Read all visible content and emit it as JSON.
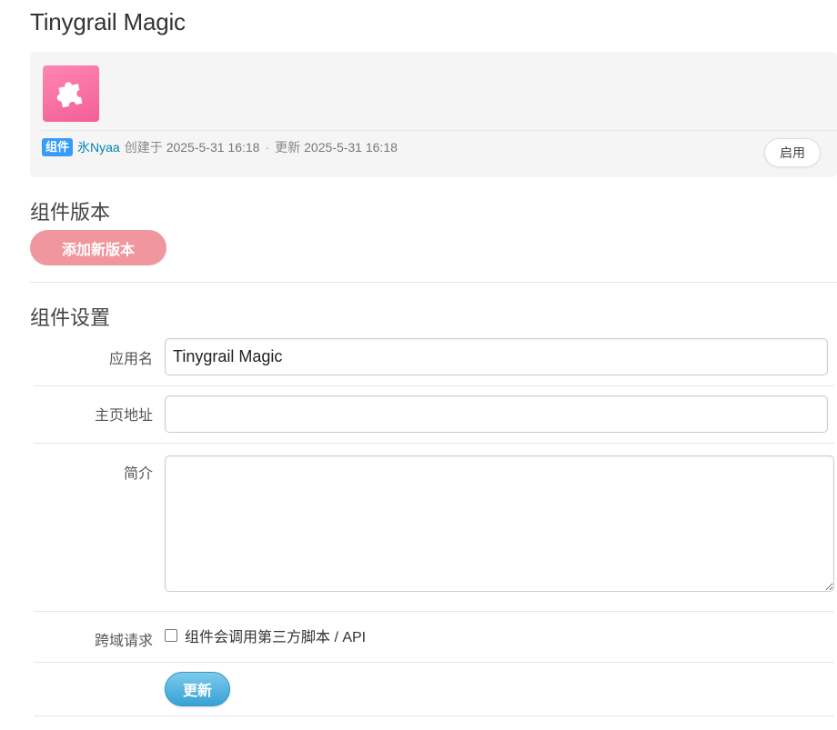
{
  "page": {
    "title": "Tinygrail Magic"
  },
  "component": {
    "icon": "puzzle-piece-icon",
    "type_badge": "组件",
    "author": "氷Nyaa",
    "created_label": "创建于",
    "created_at": "2025-5-31 16:18",
    "separator": "·",
    "updated_label": "更新",
    "updated_at": "2025-5-31 16:18",
    "enable_label": "启用"
  },
  "versions": {
    "title": "组件版本",
    "add_label": "添加新版本"
  },
  "settings": {
    "title": "组件设置",
    "app_name_label": "应用名",
    "app_name_value": "Tinygrail Magic",
    "homepage_label": "主页地址",
    "homepage_value": "",
    "intro_label": "简介",
    "intro_value": "",
    "cors_label": "跨域请求",
    "cors_checkbox_label": "组件会调用第三方脚本 / API",
    "cors_checked": false,
    "update_label": "更新"
  },
  "colors": {
    "badge": "#369cf8",
    "author_link": "#0084b4",
    "add_button": "#f0969f",
    "update_button": "#36a2d6",
    "icon_bg": "#f35f97"
  }
}
